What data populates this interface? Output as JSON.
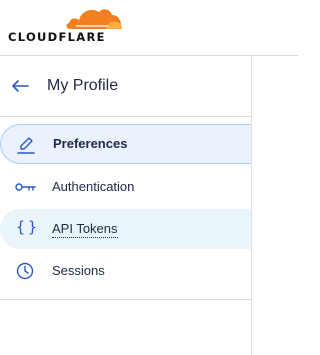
{
  "brand": {
    "name": "CLOUDFLARE",
    "logo_icon": "cloudflare-cloud-logo",
    "cloud_color_main": "#F38020",
    "cloud_color_light": "#FAAE40"
  },
  "profile": {
    "back_icon": "arrow-left-icon",
    "title": "My Profile"
  },
  "nav": {
    "items": [
      {
        "label": "Preferences",
        "icon": "pencil-icon",
        "state": "active"
      },
      {
        "label": "Authentication",
        "icon": "key-icon",
        "state": "default"
      },
      {
        "label": "API Tokens",
        "icon": "braces-icon",
        "state": "hover"
      },
      {
        "label": "Sessions",
        "icon": "clock-icon",
        "state": "default"
      }
    ]
  },
  "colors": {
    "accent": "#2B59C3",
    "active_bg": "#EAF3FD",
    "active_border": "#A9CDF2",
    "text": "#1F2A44"
  }
}
